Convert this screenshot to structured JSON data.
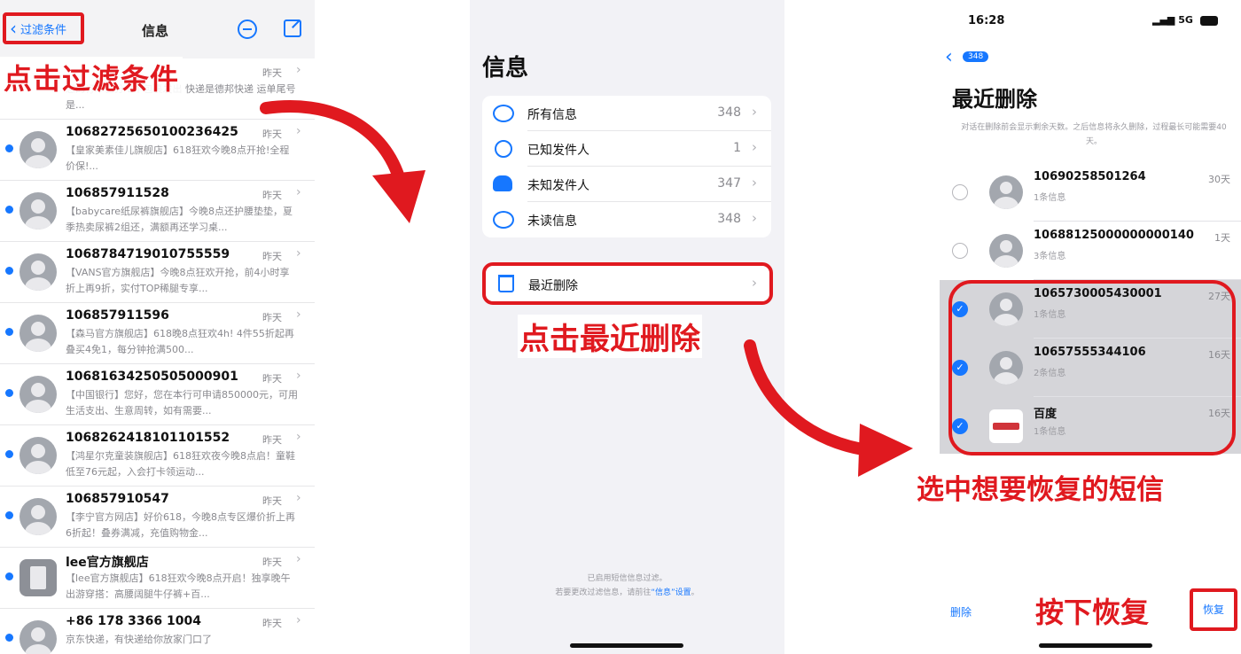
{
  "colors": {
    "accent": "#1677ff",
    "annotation_red": "#e0191f",
    "unread_dot": "#1677ff",
    "selected_row_bg": "#d5d5d9"
  },
  "panel1": {
    "back_label": "过滤条件",
    "title": "信息",
    "annotation": "点击过滤条件",
    "partial_row": {
      "time": "昨天",
      "preview": "您的订单已分 2个包裹发出 快递是德邦快递 运单尾号是..."
    },
    "messages": [
      {
        "name": "10682725650100236425",
        "time": "昨天",
        "preview": "【皇家美素佳儿旗舰店】618狂欢今晚8点开抢!全程价保!...",
        "avatar": "person-icon"
      },
      {
        "name": "106857911528",
        "time": "昨天",
        "preview": "【babycare纸尿裤旗舰店】今晚8点还护腰垫垫，夏季热卖尿裤2组还，满额再还学习桌...",
        "avatar": "person-icon"
      },
      {
        "name": "1068784719010755559",
        "time": "昨天",
        "preview": "【VANS官方旗舰店】今晚8点狂欢开抢，前4小时享折上再9折，实付TOP稀腿专享...",
        "avatar": "person-icon"
      },
      {
        "name": "106857911596",
        "time": "昨天",
        "preview": "【森马官方旗舰店】618晚8点狂欢4h! 4件55折起再叠买4免1，每分钟抢满500...",
        "avatar": "person-icon"
      },
      {
        "name": "10681634250505000901",
        "time": "昨天",
        "preview": "【中国银行】您好，您在本行可申请850000元，可用生活支出、生意周转，如有需要...",
        "avatar": "person-icon"
      },
      {
        "name": "106826241810110155​2",
        "time": "昨天",
        "preview": "【鸿星尔克童装旗舰店】618狂欢夜今晚8点启！童鞋低至76元起，入会打卡领运动...",
        "avatar": "person-icon"
      },
      {
        "name": "106857910547",
        "time": "昨天",
        "preview": "【李宁官方网店】好价618，今晚8点专区爆价折上再6折起！叠券满减，充值购物金...",
        "avatar": "person-icon"
      },
      {
        "name": "lee官方旗舰店",
        "time": "昨天",
        "preview": "【lee官方旗舰店】618狂欢今晚8点开启！独享晚午出游穿搭：高腰阔腿牛仔裤+百...",
        "avatar": "building-icon"
      },
      {
        "name": "+86 178 3366 1004",
        "time": "昨天",
        "preview": "京东快递，有快递给你放家门口了",
        "avatar": "person-icon"
      }
    ]
  },
  "panel2": {
    "title": "信息",
    "filters": [
      {
        "label": "所有信息",
        "count": "348",
        "icon": "chat-bubbles-icon"
      },
      {
        "label": "已知发件人",
        "count": "1",
        "icon": "person-circle-icon"
      },
      {
        "label": "未知发件人",
        "count": "347",
        "icon": "people-icon"
      },
      {
        "label": "未读信息",
        "count": "348",
        "icon": "unread-bubble-icon"
      }
    ],
    "recently_deleted": "最近删除",
    "annotation": "点击最近删除",
    "footer_line1": "已启用短信信息过滤。",
    "footer_line2_a": "若要更改过滤信息，请前往",
    "footer_link": "“信息”设置",
    "footer_line2_b": "。"
  },
  "panel3": {
    "status_time": "16:28",
    "status_right": "5G",
    "back_badge": "348",
    "title": "最近删除",
    "description": "对话在删除前会显示剩余天数。之后信息将永久删除，过程最长可能需要40天。",
    "rows": [
      {
        "name": "10690258501264",
        "sub": "1条信息",
        "days": "30天",
        "selected": false,
        "avatar": "person-icon"
      },
      {
        "name": "10688125000000000140",
        "sub": "3条信息",
        "days": "1天",
        "selected": false,
        "avatar": "person-icon"
      },
      {
        "name": "1065730005430001",
        "sub": "1条信息",
        "days": "27天",
        "selected": true,
        "avatar": "person-icon"
      },
      {
        "name": "10657555344106",
        "sub": "2条信息",
        "days": "16天",
        "selected": true,
        "avatar": "person-icon"
      },
      {
        "name": "百度",
        "sub": "1条信息",
        "days": "16天",
        "selected": true,
        "avatar": "baidu-logo-icon"
      }
    ],
    "annotation_select": "选中想要恢复的短信",
    "delete_label": "删除",
    "annotation_press": "按下恢复",
    "recover_label": "恢复"
  }
}
